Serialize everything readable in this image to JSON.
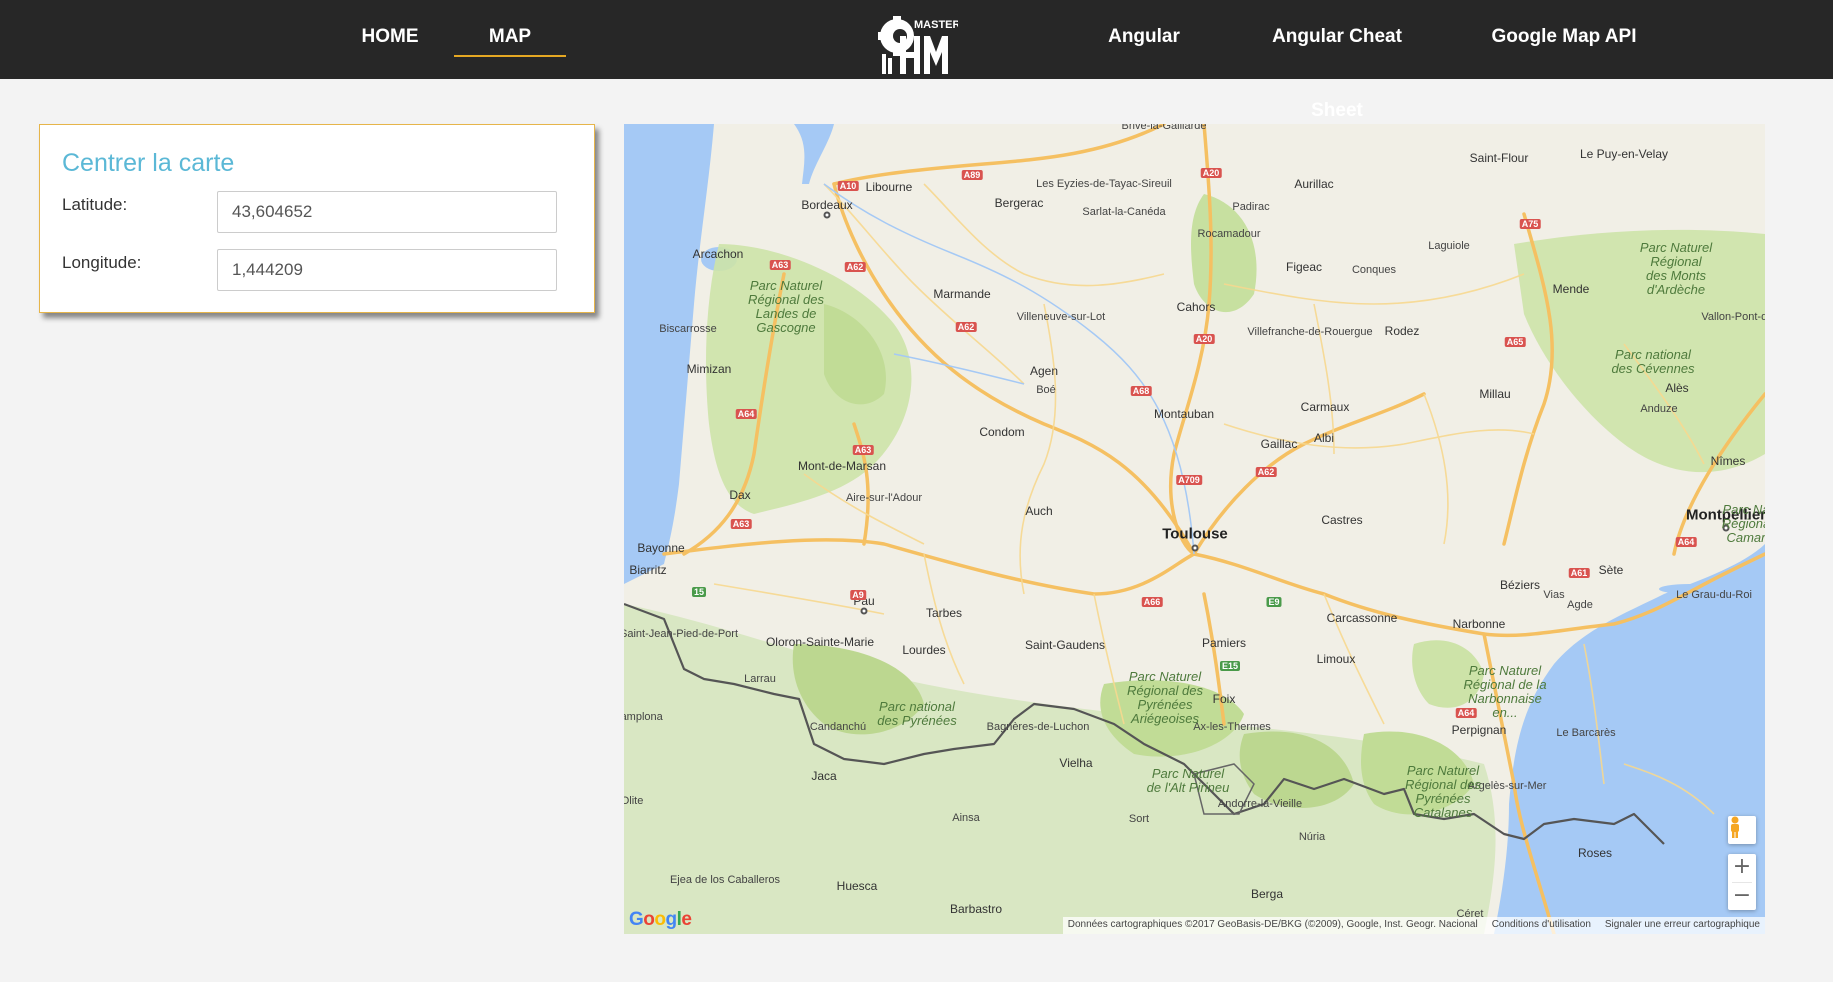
{
  "nav": {
    "left": [
      {
        "label": "HOME",
        "active": false
      },
      {
        "label": "MAP",
        "active": true
      }
    ],
    "logo_text": "MASTER IHM",
    "right": [
      {
        "label": "Angular"
      },
      {
        "label": "Angular Cheat Sheet"
      },
      {
        "label": "Google Map API"
      }
    ],
    "accent_color": "#e5a823"
  },
  "center_form": {
    "title": "Centrer la carte",
    "latitude_label": "Latitude:",
    "latitude_value": "43,604652",
    "longitude_label": "Longitude:",
    "longitude_value": "1,444209"
  },
  "map": {
    "cities": [
      "Brive-la-Gaillarde",
      "Saint-Flour",
      "Le Puy-en-Velay",
      "Libourne",
      "Bergerac",
      "Les Eyzies-de-Tayac-Sireuil",
      "Aurillac",
      "Bordeaux",
      "Sarlat-la-Canéda",
      "Padirac",
      "Rocamadour",
      "Arcachon",
      "Laguiole",
      "Figeac",
      "Conques",
      "Mende",
      "Marmande",
      "Villeneuve-sur-Lot",
      "Cahors",
      "Biscarrosse",
      "Villefranche-de-Rouergue",
      "Rodez",
      "Vallon-Pont-d'A",
      "Mimizan",
      "Agen",
      "Boé",
      "Millau",
      "Alès",
      "Montauban",
      "Carmaux",
      "Anduze",
      "Condom",
      "Gaillac",
      "Albi",
      "Mont-de-Marsan",
      "Nîmes",
      "Dax",
      "Aire-sur-l'Adour",
      "Auch",
      "Toulouse",
      "Castres",
      "Montpellier",
      "Bayonne",
      "Biarritz",
      "Sète",
      "Le Grau-du-Roi",
      "Béziers",
      "Vias",
      "Agde",
      "Pau",
      "Tarbes",
      "Carcassonne",
      "Narbonne",
      "Saint-Jean-Pied-de-Port",
      "Oloron-Sainte-Marie",
      "Lourdes",
      "Saint-Gaudens",
      "Pamiers",
      "Limoux",
      "Larrau",
      "Foix",
      "Candanchú",
      "Bagnères-de-Luchon",
      "Ax-les-Thermes",
      "Perpignan",
      "Le Barcarès",
      "Vielha",
      "Jaca",
      "Andorre-la-Vieille",
      "Argelès-sur-Mer",
      "Ainsa",
      "Sort",
      "Núria",
      "Roses",
      "Ejea de los Caballeros",
      "Huesca",
      "Berga",
      "Barbastro",
      "Céret",
      "Pamplona",
      "Olite"
    ],
    "parks": [
      "Parc Naturel\nRégional des\nLandes de\nGascogne",
      "Parc Naturel\nRégional\ndes Monts\nd'Ardèche",
      "Parc national\ndes Cévennes",
      "Parc national\ndes Pyrénées",
      "Parc Naturel\nRégional des\nPyrénées\nAriégeoises",
      "Parc Naturel\nRégional de la\nNarbonnaise\nen...",
      "Parc Naturel\nde l'Alt Pirineu",
      "Parc Naturel\nRégional des\nPyrénées\nCatalanes",
      "Parc Na\nRégiona\nCamar"
    ],
    "roads": [
      "A89",
      "A20",
      "A10",
      "A63",
      "A62",
      "A75",
      "A20",
      "A62",
      "A65",
      "A68",
      "A63",
      "A62",
      "A64",
      "A709",
      "A9",
      "A64",
      "A61",
      "A66",
      "E9",
      "E15",
      "A64",
      "A63",
      "15"
    ],
    "controls": {
      "zoom_in": "+",
      "zoom_out": "−"
    },
    "google_logo": "Google",
    "attribution": "Données cartographiques ©2017 GeoBasis-DE/BKG (©2009), Google, Inst. Geogr. Nacional",
    "terms": "Conditions d'utilisation",
    "report": "Signaler une erreur cartographique",
    "colors": {
      "land": "#f1efe6",
      "sea": "#a5c9f5",
      "forest": "#cde3a8",
      "motorway": "#f5c062",
      "border": "#555555"
    }
  }
}
